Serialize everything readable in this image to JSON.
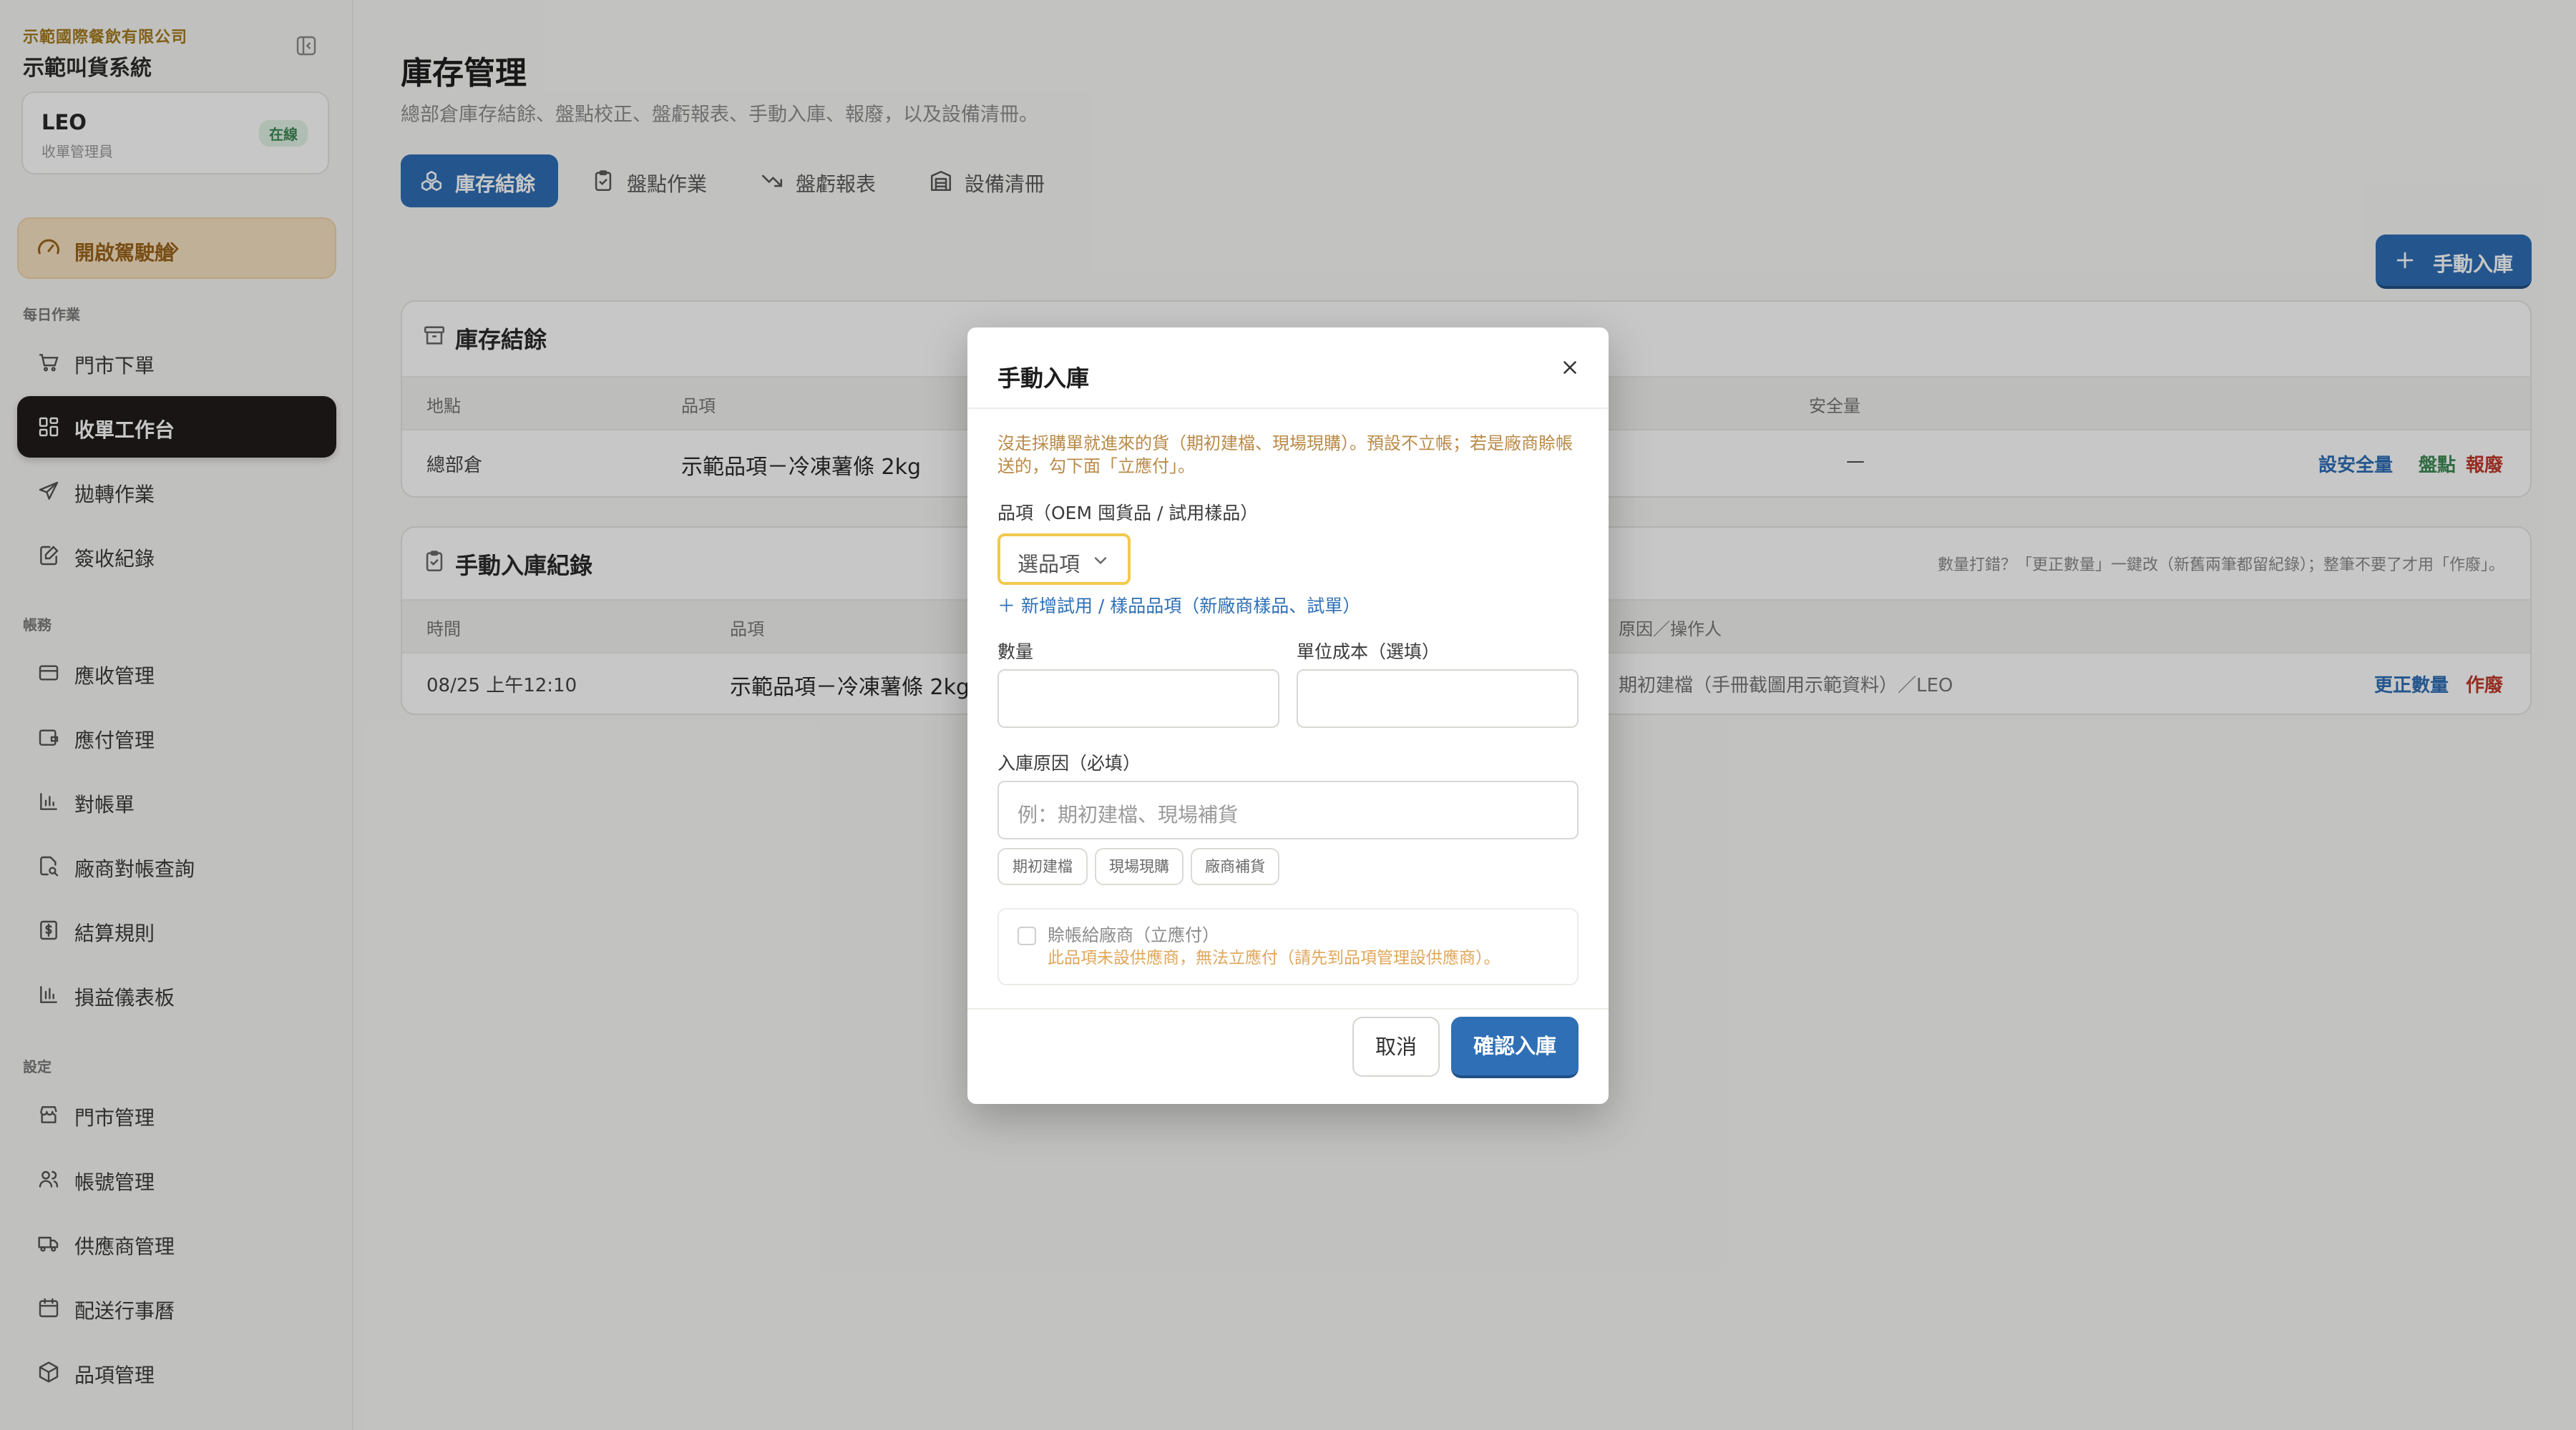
{
  "sidebar": {
    "company": "示範國際餐飲有限公司",
    "system": "示範叫貨系統",
    "user": {
      "name": "LEO",
      "role": "收單管理員",
      "status": "在線"
    },
    "dashboard_label": "開啟駕駛艙",
    "sections": {
      "daily": "每日作業",
      "accounts": "帳務",
      "settings": "設定"
    },
    "items": [
      {
        "label": "門市下單",
        "icon": "cart-icon"
      },
      {
        "label": "收單工作台",
        "icon": "grid-icon",
        "active": true
      },
      {
        "label": "拋轉作業",
        "icon": "send-icon"
      },
      {
        "label": "簽收紀錄",
        "icon": "edit-doc-icon"
      },
      {
        "label": "應收管理",
        "icon": "card-icon"
      },
      {
        "label": "應付管理",
        "icon": "wallet-icon"
      },
      {
        "label": "對帳單",
        "icon": "bar-chart-icon"
      },
      {
        "label": "廠商對帳查詢",
        "icon": "doc-search-icon"
      },
      {
        "label": "結算規則",
        "icon": "dollar-doc-icon"
      },
      {
        "label": "損益儀表板",
        "icon": "bar-chart-icon"
      },
      {
        "label": "門市管理",
        "icon": "store-icon"
      },
      {
        "label": "帳號管理",
        "icon": "users-icon"
      },
      {
        "label": "供應商管理",
        "icon": "truck-icon"
      },
      {
        "label": "配送行事曆",
        "icon": "calendar-icon"
      },
      {
        "label": "品項管理",
        "icon": "box-icon"
      }
    ]
  },
  "main": {
    "title": "庫存管理",
    "subtitle": "總部倉庫存結餘、盤點校正、盤虧報表、手動入庫、報廢，以及設備清冊。",
    "tabs": [
      {
        "label": "庫存結餘",
        "icon": "boxes-icon",
        "active": true
      },
      {
        "label": "盤點作業",
        "icon": "clipboard-icon"
      },
      {
        "label": "盤虧報表",
        "icon": "trend-down-icon"
      },
      {
        "label": "設備清冊",
        "icon": "building-icon"
      }
    ],
    "manual_in_button": "手動入庫",
    "balance_card": {
      "title": "庫存結餘",
      "headers": {
        "location": "地點",
        "item": "品項",
        "safety": "安全量"
      },
      "row": {
        "location": "總部倉",
        "item": "示範品項－冷凍薯條 2kg",
        "safety": "—"
      },
      "actions": {
        "set_safety": "設安全量",
        "count": "盤點",
        "scrap": "報廢"
      }
    },
    "log_card": {
      "title": "手動入庫紀錄",
      "hint": "數量打錯？「更正數量」一鍵改（新舊兩筆都留紀錄）；整筆不要了才用「作廢」。",
      "headers": {
        "time": "時間",
        "item": "品項",
        "reason": "原因／操作人"
      },
      "row": {
        "time": "08/25 上午12:10",
        "item": "示範品項－冷凍薯條 2kg",
        "reason": "期初建檔（手冊截圖用示範資料）／LEO"
      },
      "actions": {
        "correct": "更正數量",
        "void": "作廢"
      }
    }
  },
  "modal": {
    "title": "手動入庫",
    "note": "沒走採購單就進來的貨（期初建檔、現場現購）。預設不立帳；若是廠商賒帳送的，勾下面「立應付」。",
    "item_label": "品項（OEM 囤貨品 / 試用樣品）",
    "item_select": "選品項",
    "add_trial_link": "＋ 新增試用 / 樣品品項（新廠商樣品、試單）",
    "qty_label": "數量",
    "unit_cost_label": "單位成本（選填）",
    "reason_label": "入庫原因（必填）",
    "reason_placeholder": "例：期初建檔、現場補貨",
    "chips": [
      "期初建檔",
      "現場現購",
      "廠商補貨"
    ],
    "supplier_label": "賒帳給廠商（立應付）",
    "supplier_warning": "此品項未設供應商，無法立應付（請先到品項管理設供應商）。",
    "cancel": "取消",
    "confirm": "確認入庫"
  }
}
